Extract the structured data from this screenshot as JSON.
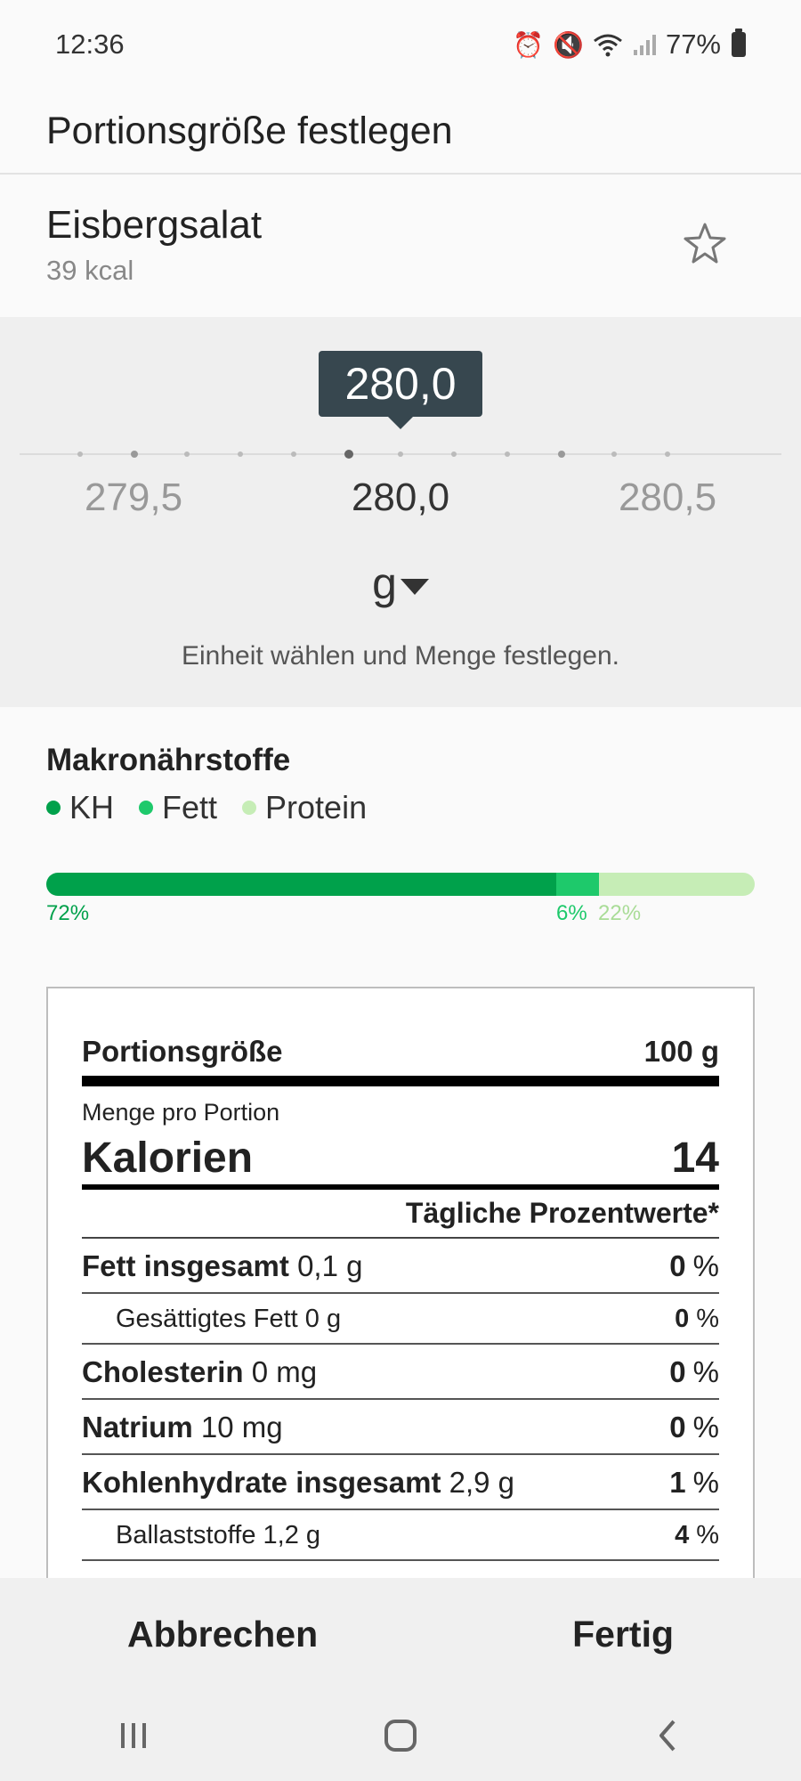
{
  "status": {
    "time": "12:36",
    "battery": "77%"
  },
  "header": {
    "title": "Portionsgröße festlegen"
  },
  "food": {
    "name": "Eisbergsalat",
    "kcal": "39 kcal"
  },
  "picker": {
    "value": "280,0",
    "labels": [
      "279,5",
      "280,0",
      "280,5"
    ],
    "unit": "g",
    "hint": "Einheit wählen und Menge festlegen."
  },
  "macros": {
    "title": "Makronährstoffe",
    "legend": [
      {
        "label": "KH",
        "color": "#00a14b"
      },
      {
        "label": "Fett",
        "color": "#1ec96b"
      },
      {
        "label": "Protein",
        "color": "#c6edb6"
      }
    ],
    "percentages": [
      {
        "label": "72%",
        "value": 72,
        "color": "#00a14b"
      },
      {
        "label": "6%",
        "value": 6,
        "color": "#1ec96b"
      },
      {
        "label": "22%",
        "value": 22,
        "color": "#c6edb6"
      }
    ]
  },
  "nutrition": {
    "serving_label": "Portionsgröße",
    "serving_value": "100 g",
    "per_portion": "Menge pro Portion",
    "calories_label": "Kalorien",
    "calories_value": "14",
    "dv_header": "Tägliche Prozentwerte*",
    "rows": [
      {
        "name": "Fett insgesamt",
        "amount": "0,1 g",
        "pct": "0",
        "sub": false
      },
      {
        "name": "Gesättigtes Fett",
        "amount": "0 g",
        "pct": "0",
        "sub": true
      },
      {
        "name": "Cholesterin",
        "amount": "0 mg",
        "pct": "0",
        "sub": false
      },
      {
        "name": "Natrium",
        "amount": "10 mg",
        "pct": "0",
        "sub": false
      },
      {
        "name": "Kohlenhydrate insgesamt",
        "amount": "2,9 g",
        "pct": "1",
        "sub": false
      },
      {
        "name": "Ballaststoffe",
        "amount": "1,2 g",
        "pct": "4",
        "sub": true
      }
    ],
    "pct_unit": "%"
  },
  "actions": {
    "cancel": "Abbrechen",
    "done": "Fertig"
  }
}
